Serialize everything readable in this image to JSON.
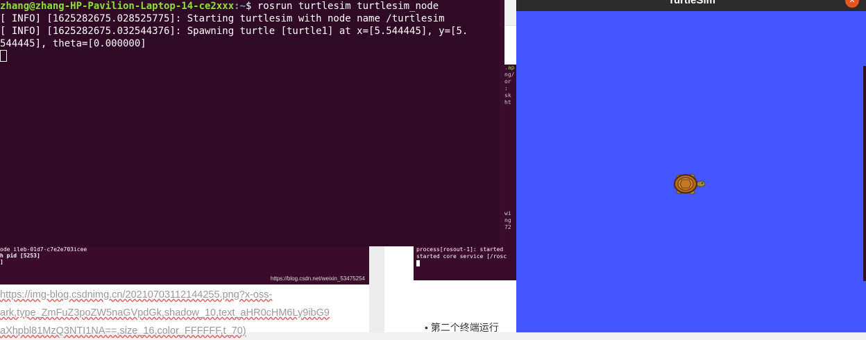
{
  "terminal": {
    "prompt_user": "zhang@zhang-HP-Pavilion-Laptop-14-ce2xxx",
    "prompt_path": ":~",
    "prompt_dollar": "$ ",
    "command": "rosrun turtlesim turtlesim_node",
    "line1": "[ INFO] [1625282675.028525775]: Starting turtlesim with node name /turtlesim",
    "line2": "[ INFO] [1625282675.032544376]: Spawning turtle [turtle1] at x=[5.544445], y=[5.",
    "line3": "544445], theta=[0.000000]"
  },
  "turtlesim": {
    "title": "TurtleSim",
    "close_glyph": "✕",
    "background_color": "#4556ff",
    "turtle_icon": "turtle-icon"
  },
  "background_page": {
    "screenshot_line1": "ode ileb-01d7-c7e2e703icee",
    "screenshot_line2": "h pid [5253]",
    "screenshot_line3": "]",
    "watermark": "https://blog.csdn.net/weixin_53475254",
    "url_line1": "https://img-blog.csdnimg.cn/20210703112144255.png?x-oss-",
    "url_line2": "ark,type_ZmFuZ3poZW5naGVpdGk,shadow_10,text_aHR0cHM6Ly9ibG9",
    "url_line3": "aXhpbl81MzQ3NTI1NA==,size_16,color_FFFFFF,t_70)",
    "term2_strip": [
      ".ap",
      "ng/",
      "or",
      ":",
      "sk",
      "",
      "ht"
    ],
    "term2_strip_lower": [
      "wi",
      "ng",
      "",
      "72"
    ],
    "term2_line1": "process[rosout-1]: started",
    "term2_line2": "started core service [/rosc",
    "bullet_text": "第二个终端运行"
  }
}
